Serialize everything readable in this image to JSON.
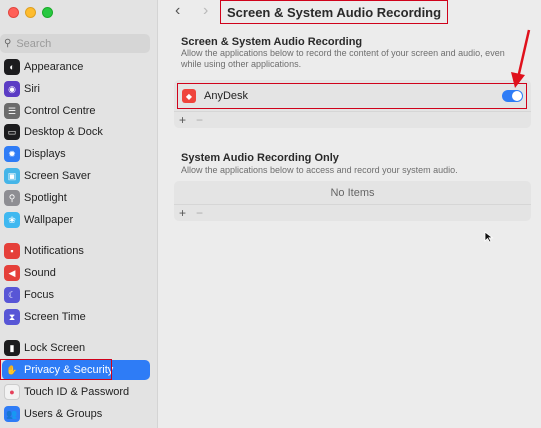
{
  "window": {
    "title": "Screen & System Audio Recording"
  },
  "sidebar": {
    "search_placeholder": "Search",
    "items": [
      {
        "label": "Appearance",
        "icon": "appearance-icon",
        "color": "#1c1c1e"
      },
      {
        "label": "Siri",
        "icon": "siri-icon",
        "color": "#5b3cc4"
      },
      {
        "label": "Control Centre",
        "icon": "control-centre-icon",
        "color": "#6b6b6b"
      },
      {
        "label": "Desktop & Dock",
        "icon": "desktop-dock-icon",
        "color": "#1c1c1e"
      },
      {
        "label": "Displays",
        "icon": "displays-icon",
        "color": "#2f7cf6"
      },
      {
        "label": "Screen Saver",
        "icon": "screen-saver-icon",
        "color": "#45b5e8"
      },
      {
        "label": "Spotlight",
        "icon": "spotlight-icon",
        "color": "#8e8e93"
      },
      {
        "label": "Wallpaper",
        "icon": "wallpaper-icon",
        "color": "#3fb8f0"
      },
      {
        "label": "Notifications",
        "icon": "notifications-icon",
        "color": "#e5403a"
      },
      {
        "label": "Sound",
        "icon": "sound-icon",
        "color": "#e5403a"
      },
      {
        "label": "Focus",
        "icon": "focus-icon",
        "color": "#5856d6"
      },
      {
        "label": "Screen Time",
        "icon": "screen-time-icon",
        "color": "#5856d6"
      },
      {
        "label": "Lock Screen",
        "icon": "lock-screen-icon",
        "color": "#1c1c1e"
      },
      {
        "label": "Privacy & Security",
        "icon": "privacy-hand-icon",
        "color": "#2e7cf6",
        "active": true
      },
      {
        "label": "Touch ID & Password",
        "icon": "touch-id-icon",
        "color": "#f2f2f2"
      },
      {
        "label": "Users & Groups",
        "icon": "users-groups-icon",
        "color": "#2f7cf6"
      }
    ]
  },
  "main": {
    "back_icon": "‹",
    "forward_icon": "›",
    "section1": {
      "title": "Screen & System Audio Recording",
      "description": "Allow the applications below to record the content of your screen and audio, even while using other applications.",
      "apps": [
        {
          "name": "AnyDesk",
          "enabled": true
        }
      ]
    },
    "section2": {
      "title": "System Audio Recording Only",
      "description": "Allow the applications below to access and record your system audio.",
      "empty_text": "No Items"
    },
    "add_label": "+",
    "remove_label": "−"
  },
  "colors": {
    "accent": "#2e7cf6",
    "highlight": "#d0021b",
    "anydesk": "#ef443b"
  }
}
